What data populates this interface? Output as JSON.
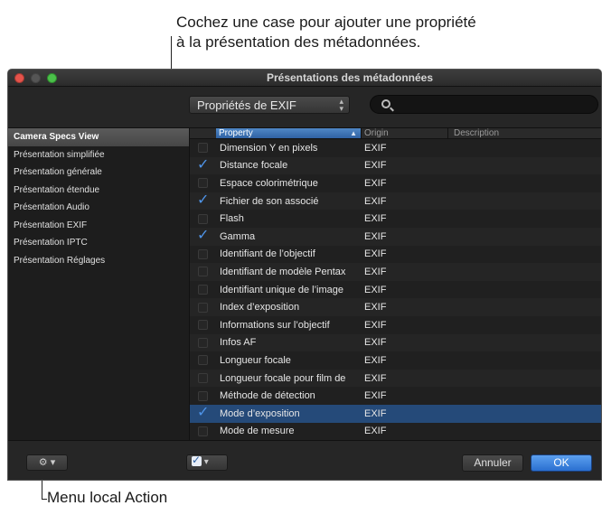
{
  "callouts": {
    "top_line1": "Cochez une case pour ajouter une propriété",
    "top_line2": "à la présentation des métadonnées.",
    "bottom": "Menu local Action"
  },
  "window": {
    "title": "Présentations des métadonnées"
  },
  "toolbar": {
    "properties_popup": "Propriétés de EXIF",
    "search_placeholder": ""
  },
  "sidebar": {
    "items": [
      {
        "label": "Camera Specs View",
        "selected": true
      },
      {
        "label": "Présentation simplifiée"
      },
      {
        "label": "Présentation générale"
      },
      {
        "label": "Présentation étendue"
      },
      {
        "label": "Présentation Audio"
      },
      {
        "label": "Présentation EXIF"
      },
      {
        "label": "Présentation IPTC"
      },
      {
        "label": "Présentation Réglages"
      }
    ]
  },
  "table": {
    "columns": {
      "property": "Property",
      "origin": "Origin",
      "description": "Description"
    },
    "rows": [
      {
        "property": "Dimension Y en pixels",
        "origin": "EXIF",
        "checked": false
      },
      {
        "property": "Distance focale",
        "origin": "EXIF",
        "checked": true
      },
      {
        "property": "Espace colorimétrique",
        "origin": "EXIF",
        "checked": false
      },
      {
        "property": "Fichier de son associé",
        "origin": "EXIF",
        "checked": true
      },
      {
        "property": "Flash",
        "origin": "EXIF",
        "checked": false
      },
      {
        "property": "Gamma",
        "origin": "EXIF",
        "checked": true
      },
      {
        "property": "Identifiant de l’objectif",
        "origin": "EXIF",
        "checked": false
      },
      {
        "property": "Identifiant de modèle Pentax",
        "origin": "EXIF",
        "checked": false
      },
      {
        "property": "Identifiant unique de l’image",
        "origin": "EXIF",
        "checked": false
      },
      {
        "property": "Index d’exposition",
        "origin": "EXIF",
        "checked": false
      },
      {
        "property": "Informations sur l’objectif",
        "origin": "EXIF",
        "checked": false
      },
      {
        "property": "Infos AF",
        "origin": "EXIF",
        "checked": false
      },
      {
        "property": "Longueur focale",
        "origin": "EXIF",
        "checked": false
      },
      {
        "property": "Longueur focale pour film de",
        "origin": "EXIF",
        "checked": false
      },
      {
        "property": "Méthode de détection",
        "origin": "EXIF",
        "checked": false
      },
      {
        "property": "Mode d’exposition",
        "origin": "EXIF",
        "checked": true,
        "selected": true
      },
      {
        "property": "Mode de mesure",
        "origin": "EXIF",
        "checked": false
      }
    ]
  },
  "footer": {
    "cancel_label": "Annuler",
    "ok_label": "OK"
  }
}
